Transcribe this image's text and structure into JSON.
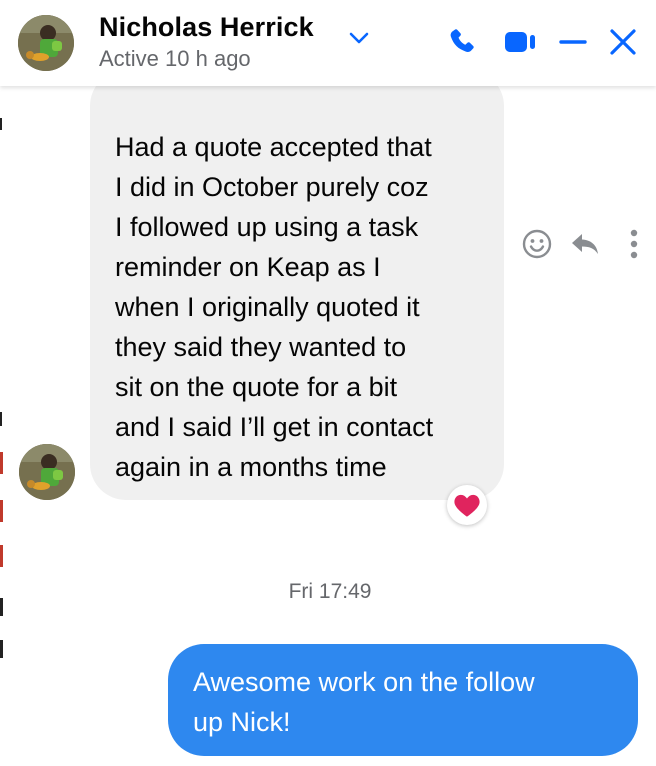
{
  "header": {
    "name": "Nicholas Herrick",
    "status": "Active 10 h ago",
    "icons": [
      "chevron-down-icon",
      "phone-icon",
      "video-icon",
      "minimize-icon",
      "close-icon"
    ]
  },
  "messages": {
    "incoming": {
      "text": "Had a quote accepted that\nI did in October purely coz\nI followed up using a task\nreminder on Keap as I\nwhen I originally quoted it\nthey said they wanted to\nsit on the quote for a bit\nand I said I’ll get in contact\nagain in a months time",
      "reaction": "heart-icon"
    },
    "timestamp": "Fri 17:49",
    "outgoing": {
      "text": "Awesome work on the follow\nup Nick!"
    }
  },
  "actions": [
    "smile-icon",
    "reply-icon",
    "more-icon"
  ],
  "colors": {
    "accent": "#0866ff",
    "incoming_bubble": "#f0f0f0",
    "outgoing_bubble": "#2e88ef",
    "secondary_text": "#65676b",
    "heart": "#e0245e"
  }
}
